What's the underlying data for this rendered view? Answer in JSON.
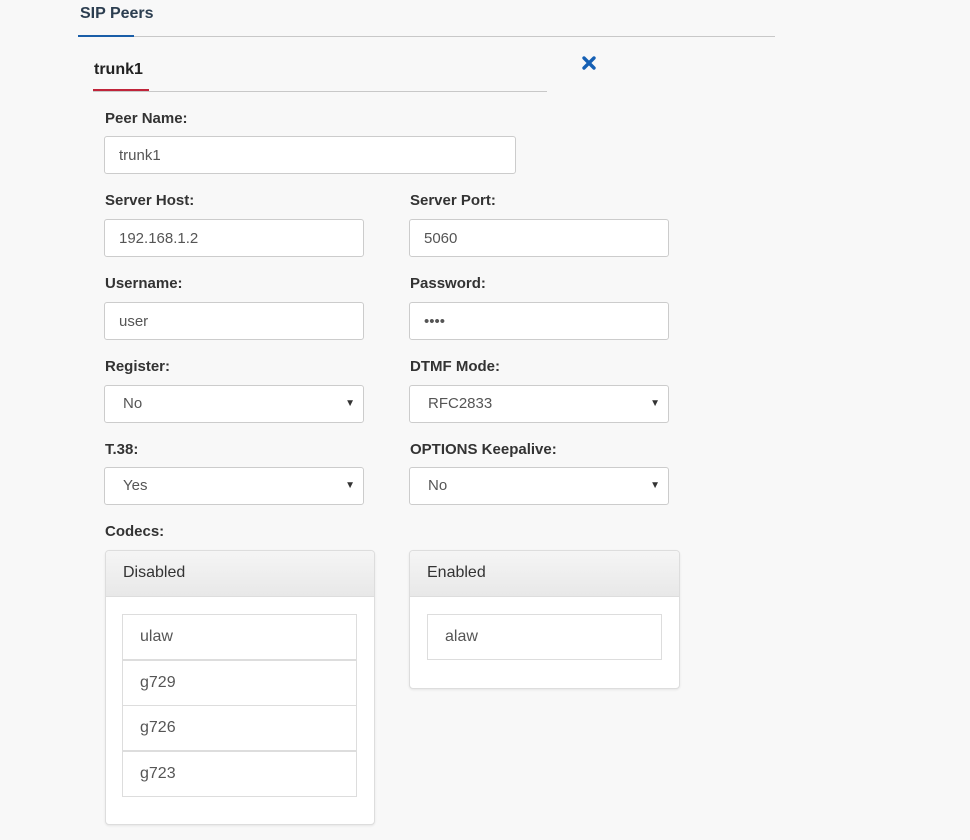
{
  "section": {
    "title": "SIP Peers"
  },
  "peer_tab": {
    "title": "trunk1",
    "close_icon": "close-x-icon",
    "close_color": "#1660b4"
  },
  "form": {
    "peer_name": {
      "label": "Peer Name:",
      "value": "trunk1"
    },
    "server_host": {
      "label": "Server Host:",
      "value": "192.168.1.2"
    },
    "server_port": {
      "label": "Server Port:",
      "value": "5060"
    },
    "username": {
      "label": "Username:",
      "value": "user"
    },
    "password": {
      "label": "Password:",
      "value": "••••"
    },
    "register": {
      "label": "Register:",
      "selected": "No"
    },
    "dtmf_mode": {
      "label": "DTMF Mode:",
      "selected": "RFC2833"
    },
    "t38": {
      "label": "T.38:",
      "selected": "Yes"
    },
    "options_keepalive": {
      "label": "OPTIONS Keepalive:",
      "selected": "No"
    }
  },
  "codecs": {
    "label": "Codecs:",
    "disabled": {
      "title": "Disabled",
      "items": [
        "ulaw",
        "g729",
        "g726",
        "g723"
      ]
    },
    "enabled": {
      "title": "Enabled",
      "items": [
        "alaw"
      ]
    }
  },
  "colors": {
    "section_accent": "#1a5ea8",
    "tab_accent": "#c0243a",
    "background": "#f8f8f8"
  }
}
